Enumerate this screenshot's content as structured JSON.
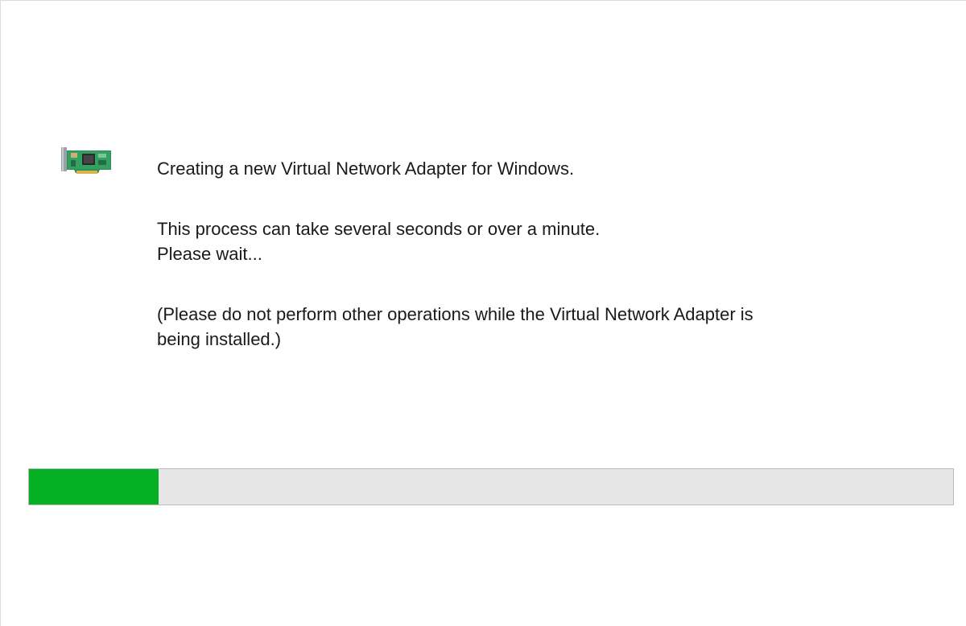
{
  "dialog": {
    "icon": "network-adapter-card-icon",
    "lines": [
      "Creating a new Virtual Network Adapter for Windows.",
      "This process can take several seconds or over a minute.",
      "Please wait...",
      "(Please do not perform other operations while the Virtual Network Adapter is",
      "being installed.)"
    ],
    "progress": {
      "percent": 14,
      "fill_color": "#06b025",
      "track_color": "#e6e6e6"
    }
  }
}
